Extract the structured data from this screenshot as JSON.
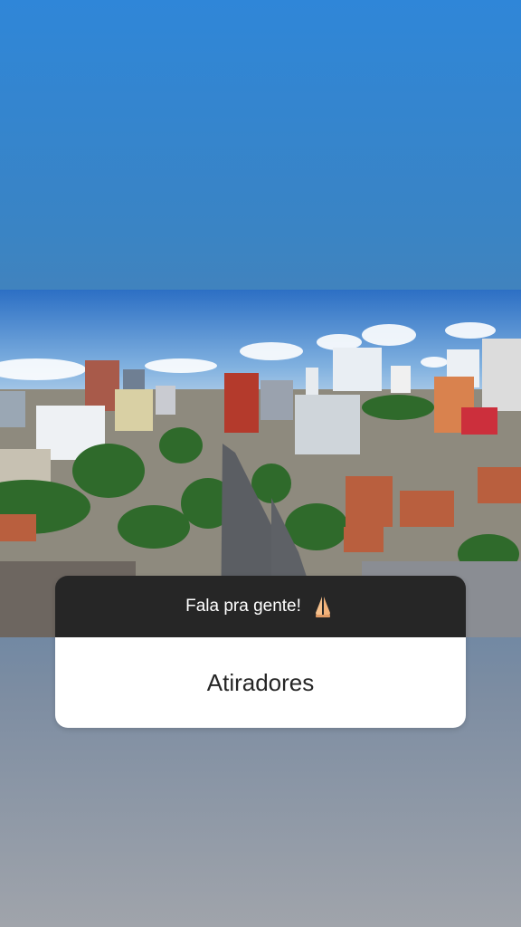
{
  "story": {
    "background_top_color": "#2f86d8",
    "background_bottom_color": "#a0a4ab"
  },
  "photo": {
    "subject": "aerial-city-avenue"
  },
  "question_sticker": {
    "prompt": "Fala pra gente!",
    "emoji_icon": "folded-hands-icon",
    "answer": "Atiradores",
    "header_color": "#262626",
    "answer_bg_color": "#ffffff"
  }
}
